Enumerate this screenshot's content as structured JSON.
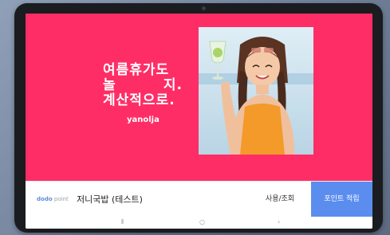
{
  "banner": {
    "background": "#ff2d66",
    "slogan_line1": "여름휴가도",
    "slogan_line2a": "놀",
    "slogan_line2b": "지.",
    "slogan_line3": "계산적으로.",
    "brand": "yanolja",
    "photo": "woman-with-drink-photo"
  },
  "bottom_bar": {
    "dodo_logo_a": "dodo",
    "dodo_logo_b": "point",
    "store_name": "저니국밥 (테스트)",
    "use_button_label": "사용/조회",
    "earn_button_label": "포인트 적립",
    "earn_button_color": "#5b8def"
  },
  "nav_bar": {
    "recent_glyph": "⦀",
    "home_glyph": "○",
    "back_glyph": "‹"
  }
}
